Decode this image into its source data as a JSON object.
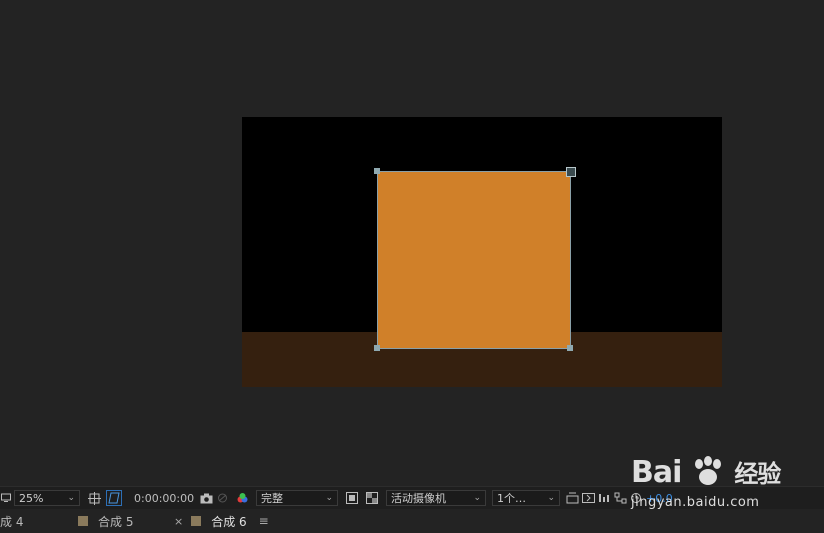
{
  "viewer": {
    "comp_background": "#000000",
    "floor_color": "#35200f",
    "solid_color": "#d08029"
  },
  "toolbar": {
    "zoom": "25%",
    "timecode": "0:00:00:00",
    "resolution": "完整",
    "camera": "活动摄像机",
    "views": "1个…",
    "exposure": "+0.0"
  },
  "tabs": [
    {
      "label": "成 4"
    },
    {
      "label": "合成 5"
    },
    {
      "label": "合成 6"
    }
  ],
  "watermark": {
    "brand_left": "Bai",
    "brand_right": "经验",
    "url": "jingyan.baidu.com"
  }
}
